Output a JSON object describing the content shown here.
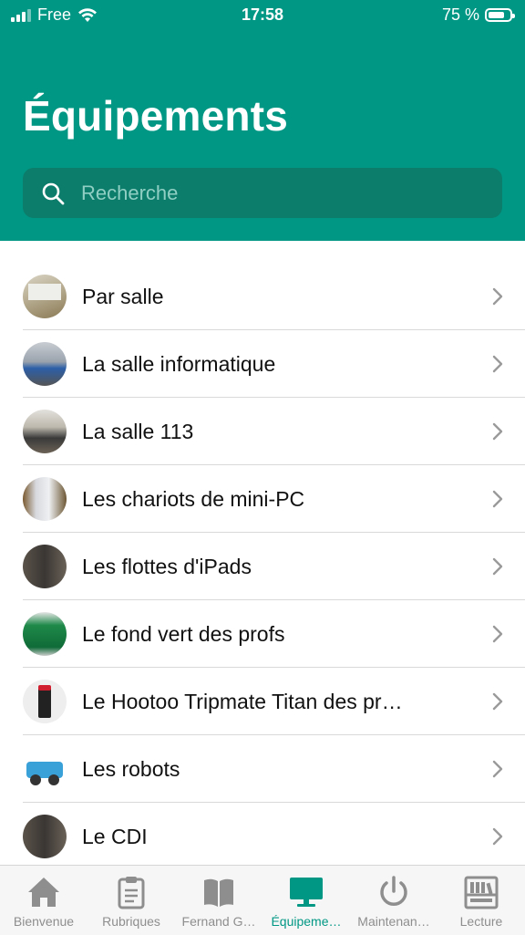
{
  "status_bar": {
    "carrier": "Free",
    "time": "17:58",
    "battery": "75 %",
    "battery_level": 0.75
  },
  "header": {
    "title": "Équipements",
    "search_placeholder": "Recherche"
  },
  "list": [
    {
      "label": "Par salle",
      "thumb": "room-photo"
    },
    {
      "label": "La salle informatique",
      "thumb": "computer-room-photo"
    },
    {
      "label": "La salle 113",
      "thumb": "classroom-photo"
    },
    {
      "label": "Les chariots de mini-PC",
      "thumb": "cart-photo"
    },
    {
      "label": "Les flottes d'iPads",
      "thumb": "ipad-cabinet-photo"
    },
    {
      "label": "Le fond vert des profs",
      "thumb": "green-screen-photo"
    },
    {
      "label": "Le Hootoo Tripmate Titan des pr…",
      "thumb": "router-photo"
    },
    {
      "label": "Les robots",
      "thumb": "robot-photo"
    },
    {
      "label": "Le CDI",
      "thumb": "cdi-photo"
    }
  ],
  "tabs": [
    {
      "label": "Bienvenue",
      "icon": "house-icon",
      "active": false
    },
    {
      "label": "Rubriques",
      "icon": "clipboard-icon",
      "active": false
    },
    {
      "label": "Fernand G…",
      "icon": "book-icon",
      "active": false
    },
    {
      "label": "Équipeme…",
      "icon": "monitor-icon",
      "active": true
    },
    {
      "label": "Maintenan…",
      "icon": "power-icon",
      "active": false
    },
    {
      "label": "Lecture",
      "icon": "library-icon",
      "active": false
    }
  ],
  "colors": {
    "accent": "#009784",
    "search_bg": "#0c7c6b",
    "tab_inactive": "#8e8e8e"
  }
}
